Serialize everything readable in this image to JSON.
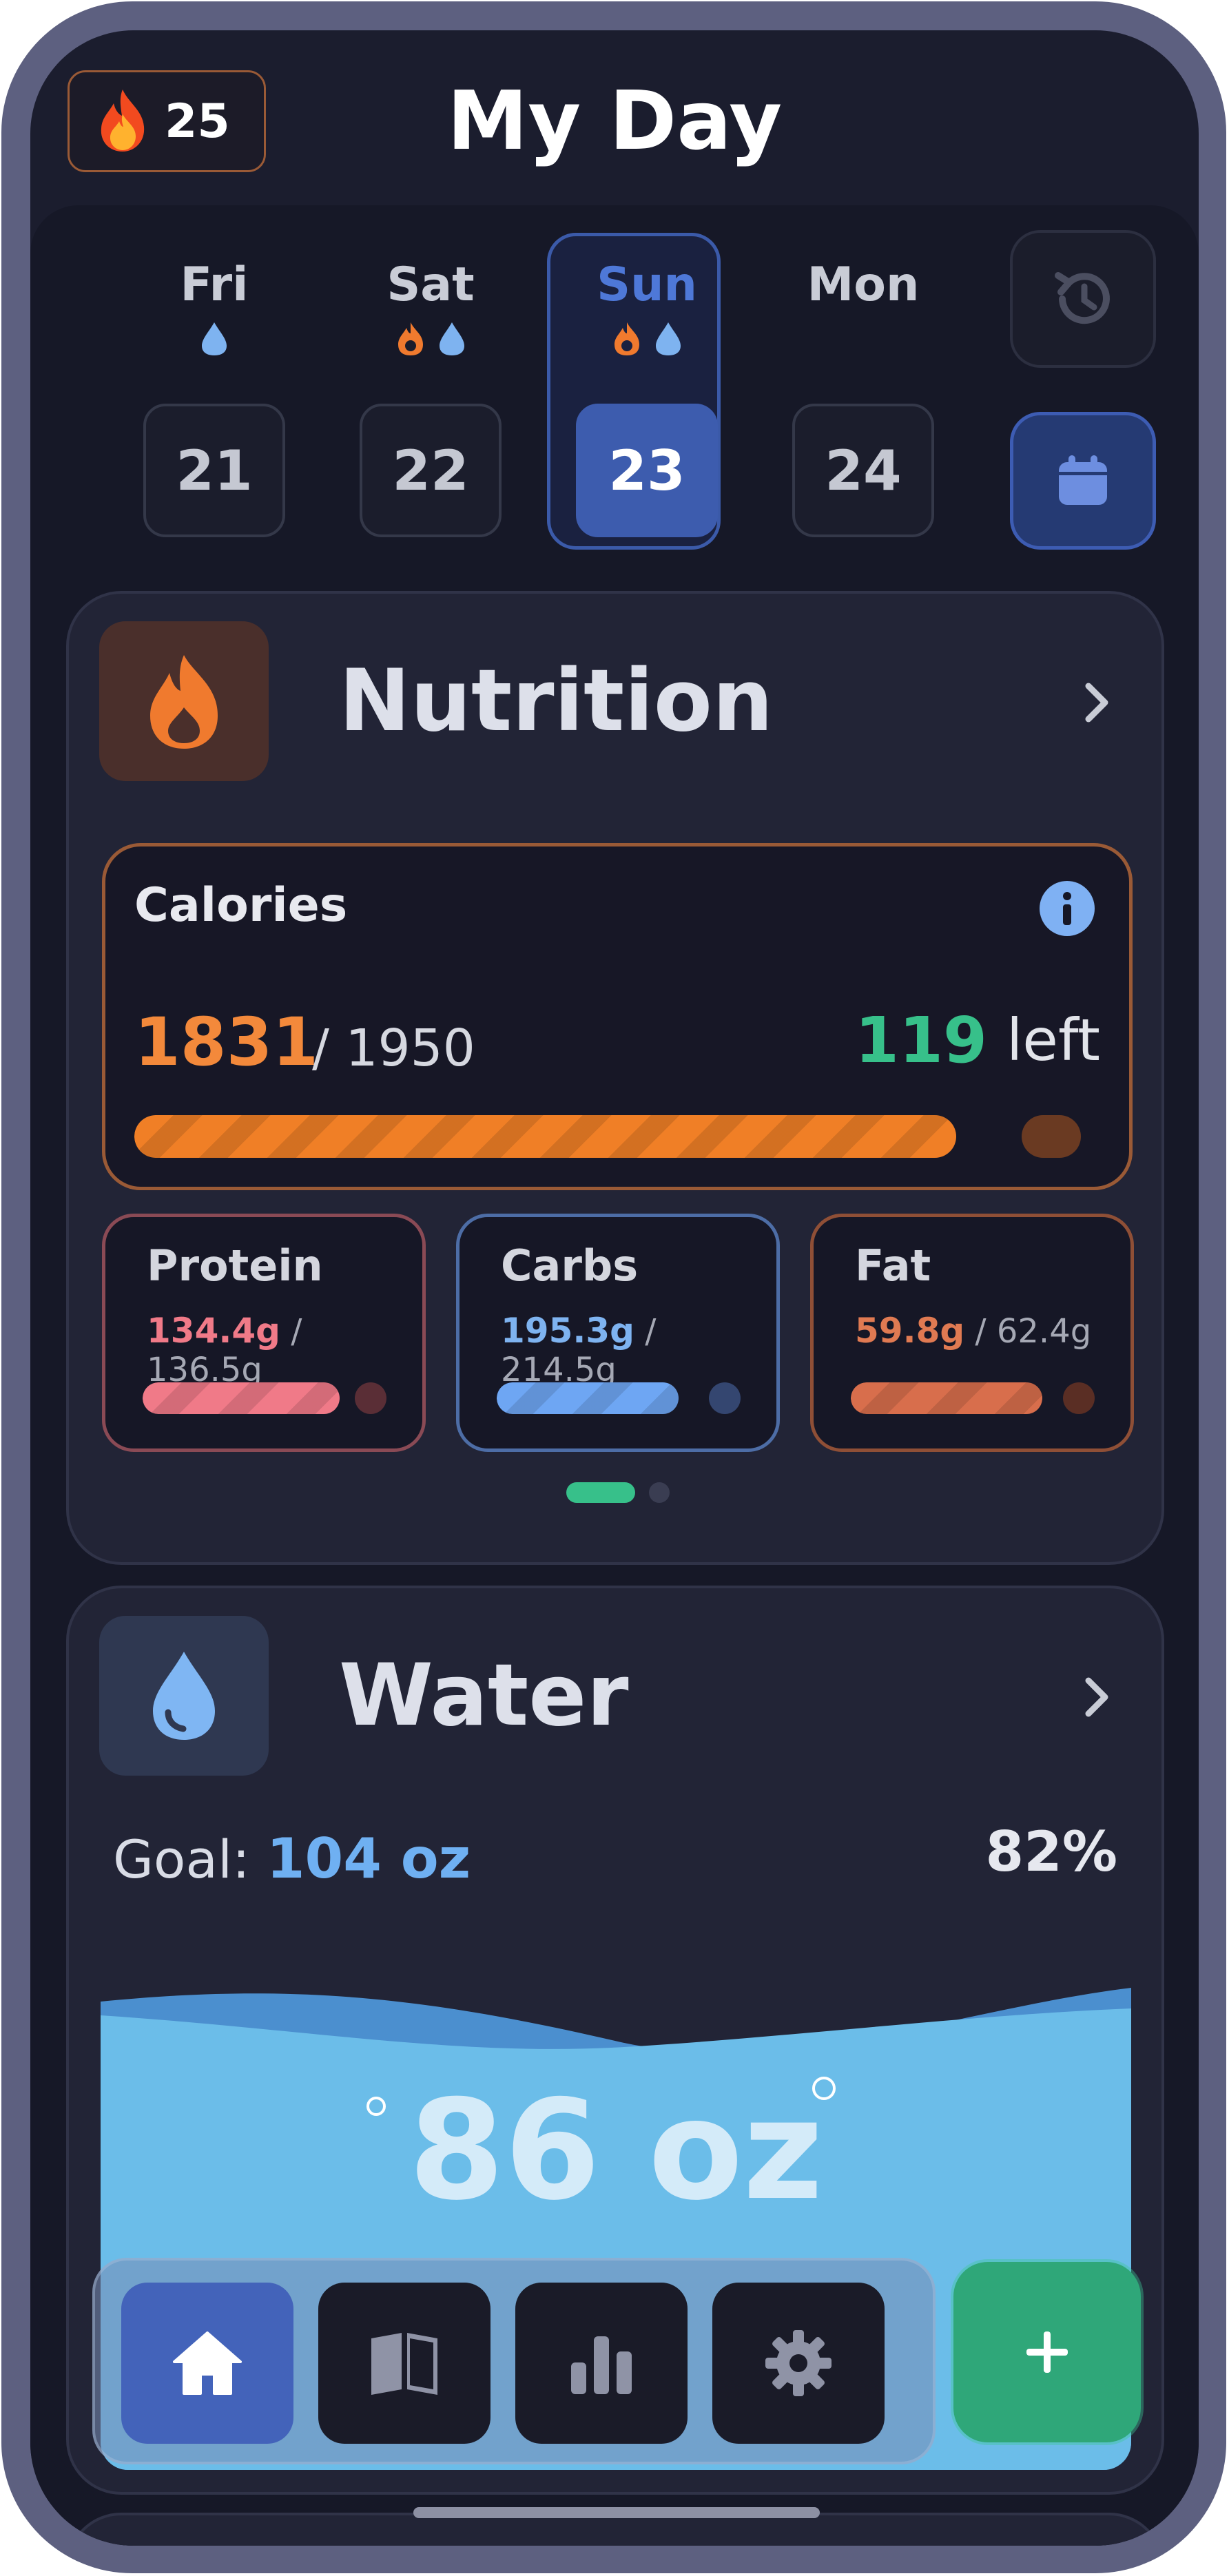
{
  "header": {
    "title": "My Day",
    "streak_count": "25"
  },
  "days": [
    {
      "name": "Fri",
      "date": "21",
      "icons": [
        "water-drop"
      ],
      "selected": false
    },
    {
      "name": "Sat",
      "date": "22",
      "icons": [
        "flame",
        "water-drop"
      ],
      "selected": false
    },
    {
      "name": "Sun",
      "date": "23",
      "icons": [
        "flame",
        "water-drop"
      ],
      "selected": true
    },
    {
      "name": "Mon",
      "date": "24",
      "icons": [],
      "selected": false
    }
  ],
  "nutrition": {
    "title": "Nutrition",
    "calories": {
      "label": "Calories",
      "consumed": "1831",
      "goal": "/ 1950",
      "left_value": "119",
      "left_label": "left",
      "progress": 0.939
    },
    "macros": [
      {
        "name": "Protein",
        "value": "134.4g",
        "goal": "/ 136.5g",
        "progress": 0.985,
        "color": "#f07a88"
      },
      {
        "name": "Carbs",
        "value": "195.3g",
        "goal": "/ 214.5g",
        "progress": 0.91,
        "color": "#6ea6f3"
      },
      {
        "name": "Fat",
        "value": "59.8g",
        "goal": "/ 62.4g",
        "progress": 0.958,
        "color": "#d86e4c"
      }
    ],
    "page_indicator": {
      "pages": 2,
      "active": 1
    }
  },
  "water": {
    "title": "Water",
    "goal_label": "Goal:",
    "goal_value": "104 oz",
    "percent": "82%",
    "amount": "86 oz",
    "fill_fraction": 0.82
  },
  "nav": {
    "items": [
      "home-icon",
      "book-icon",
      "bar-chart-icon",
      "gear-icon"
    ],
    "active": "home-icon"
  },
  "colors": {
    "accent_blue": "#3d5cae",
    "calorie_orange": "#f3893b",
    "left_green": "#37c08a",
    "water_blue": "#6fb0f2"
  }
}
